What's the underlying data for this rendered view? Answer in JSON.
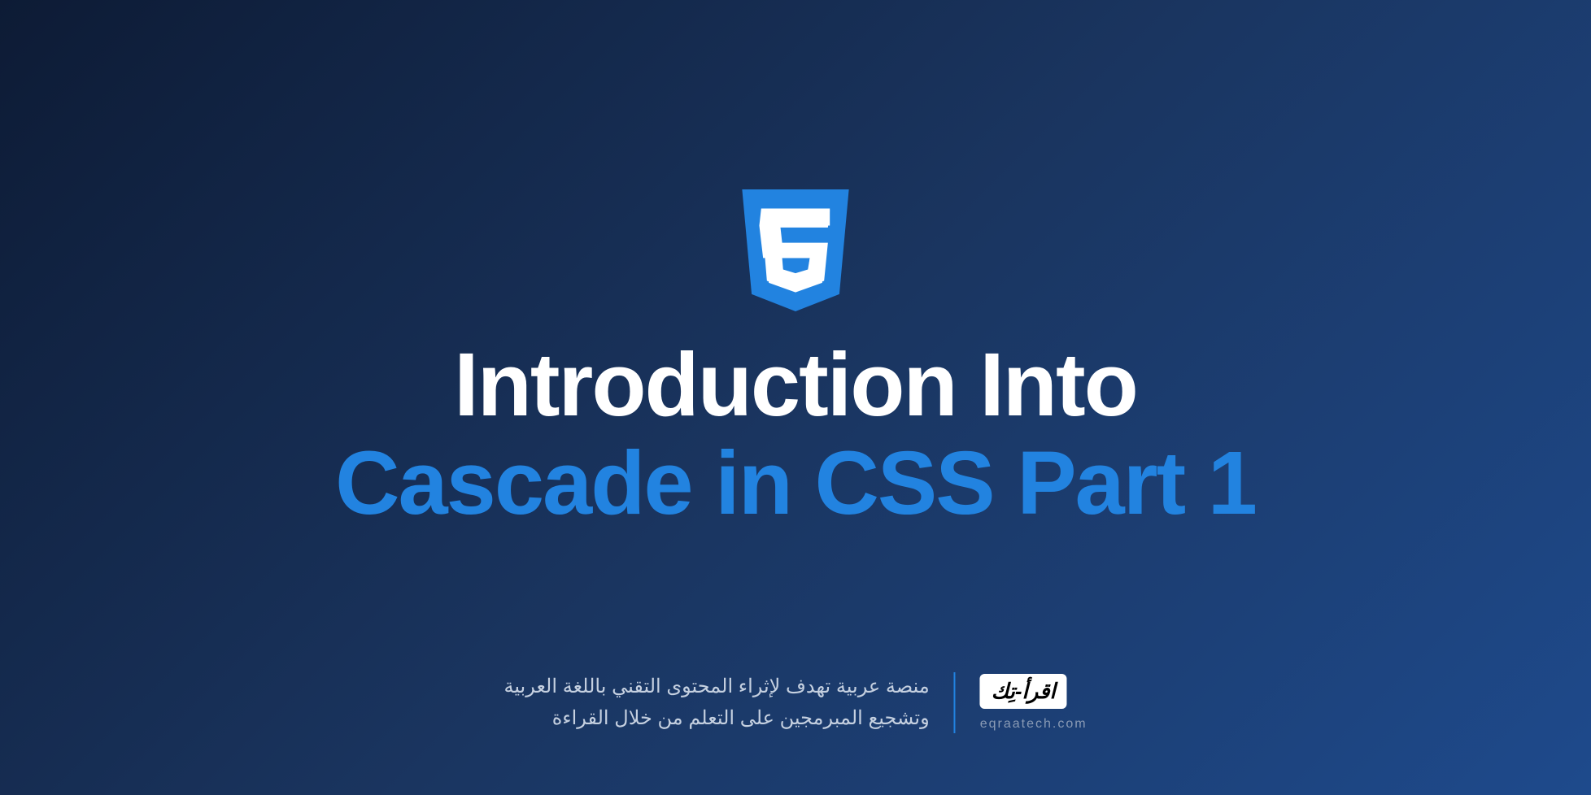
{
  "title": {
    "line1": "Introduction Into",
    "line2": "Cascade in CSS Part 1"
  },
  "footer": {
    "logo_text": "اقرأ-تِك",
    "website": "eqraatech.com",
    "tagline_line1": "منصة عربية تهدف لإثراء المحتوى التقني باللغة العربية",
    "tagline_line2": "وتشجيع المبرمجين على التعلم من خلال القراءة"
  }
}
